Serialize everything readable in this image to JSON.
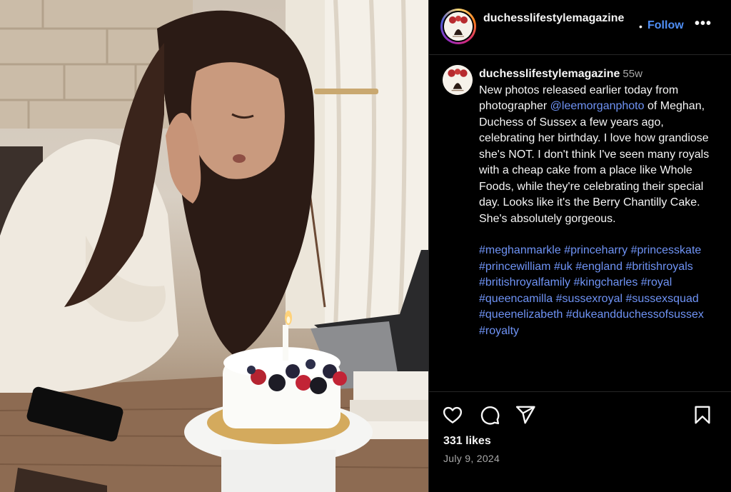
{
  "post": {
    "photo_alt": "Woman with long dark hair blowing out a candle on a berry-topped white cake on a wooden desk",
    "candle_count": 1
  },
  "header": {
    "username": "duchesslifestylemagazine",
    "separator": "•",
    "follow_label": "Follow",
    "more_label": "•••"
  },
  "caption": {
    "username": "duchesslifestylemagazine",
    "time_ago": "55w",
    "text_before_mention": "New photos released earlier today from photographer ",
    "mention": "@leemorganphoto",
    "text_after_mention": " of Meghan, Duchess of Sussex a few years ago, celebrating her birthday. I love how grandiose she's NOT. I don't think I've seen many royals with a cheap cake from a place like Whole Foods, while they're celebrating their special day. Looks like it's the Berry Chantilly Cake. She's absolutely gorgeous.",
    "hashtags": [
      "#meghanmarkle",
      "#princeharry",
      "#princesskate",
      "#princewilliam",
      "#uk",
      "#england",
      "#britishroyals",
      "#britishroyalfamily",
      "#kingcharles",
      "#royal",
      "#queencamilla",
      "#sussexroyal",
      "#sussexsquad",
      "#queenelizabeth",
      "#dukeandduchessofsussex",
      "#royalty"
    ]
  },
  "actions": {
    "like_icon": "heart-icon",
    "comment_icon": "comment-bubble-icon",
    "share_icon": "paper-plane-icon",
    "save_icon": "bookmark-icon"
  },
  "stats": {
    "likes": "331 likes",
    "date": "July 9, 2024"
  },
  "colors": {
    "link": "#6f93f5",
    "follow": "#4f8ff7",
    "muted": "#a8a8a8",
    "background": "#000000"
  }
}
